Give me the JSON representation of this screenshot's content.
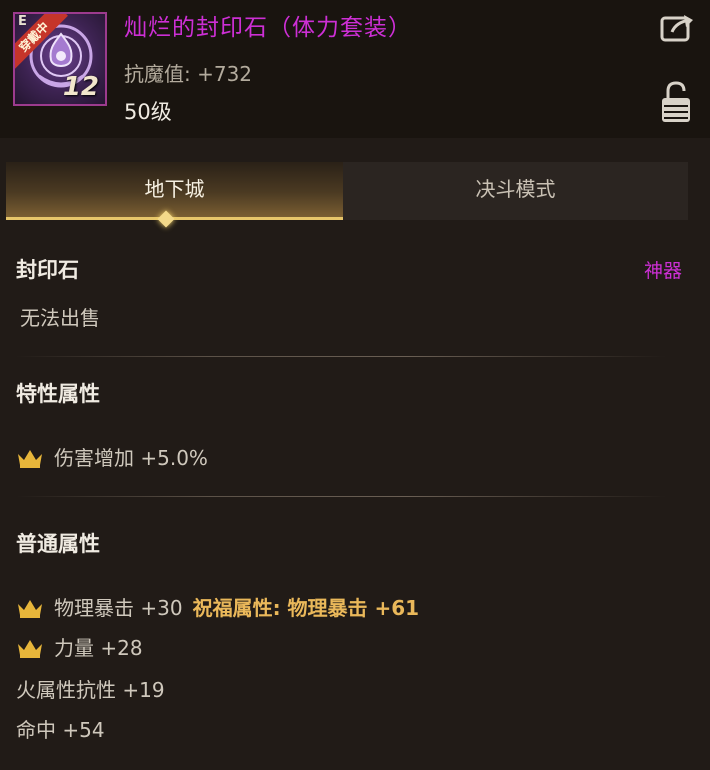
{
  "item": {
    "grade_mark": "E",
    "equipped_tag": "穿戴中",
    "reinforce_level": "12",
    "name": "灿烂的封印石（体力套装）",
    "anti_magic": "抗魔值: +732",
    "level_requirement": "50级"
  },
  "tabs": [
    {
      "label": "地下城",
      "active": true
    },
    {
      "label": "决斗模式",
      "active": false
    }
  ],
  "category": {
    "type_label": "封印石",
    "rarity_badge": "神器",
    "trade_status": "无法出售"
  },
  "special_attributes": {
    "title": "特性属性",
    "items": [
      {
        "text": "伤害增加 +5.0%",
        "icon": "crown-icon"
      }
    ]
  },
  "common_attributes": {
    "title": "普通属性",
    "items": [
      {
        "text": "物理暴击 +30",
        "blessing": "祝福属性: 物理暴击 +61",
        "icon": "crown-icon"
      },
      {
        "text": "力量 +28",
        "icon": "crown-icon"
      },
      {
        "text": "火属性抗性 +19"
      },
      {
        "text": "命中 +54"
      }
    ]
  },
  "colors": {
    "name_purple": "#cd2fd5",
    "blessing_gold": "#eab85a",
    "crown_gold": "#e8b63a",
    "tab_active_gold": "#e7c66a"
  },
  "icons": {
    "share": "share-icon",
    "lock": "lock-icon",
    "tab_marker": "diamond-icon"
  }
}
